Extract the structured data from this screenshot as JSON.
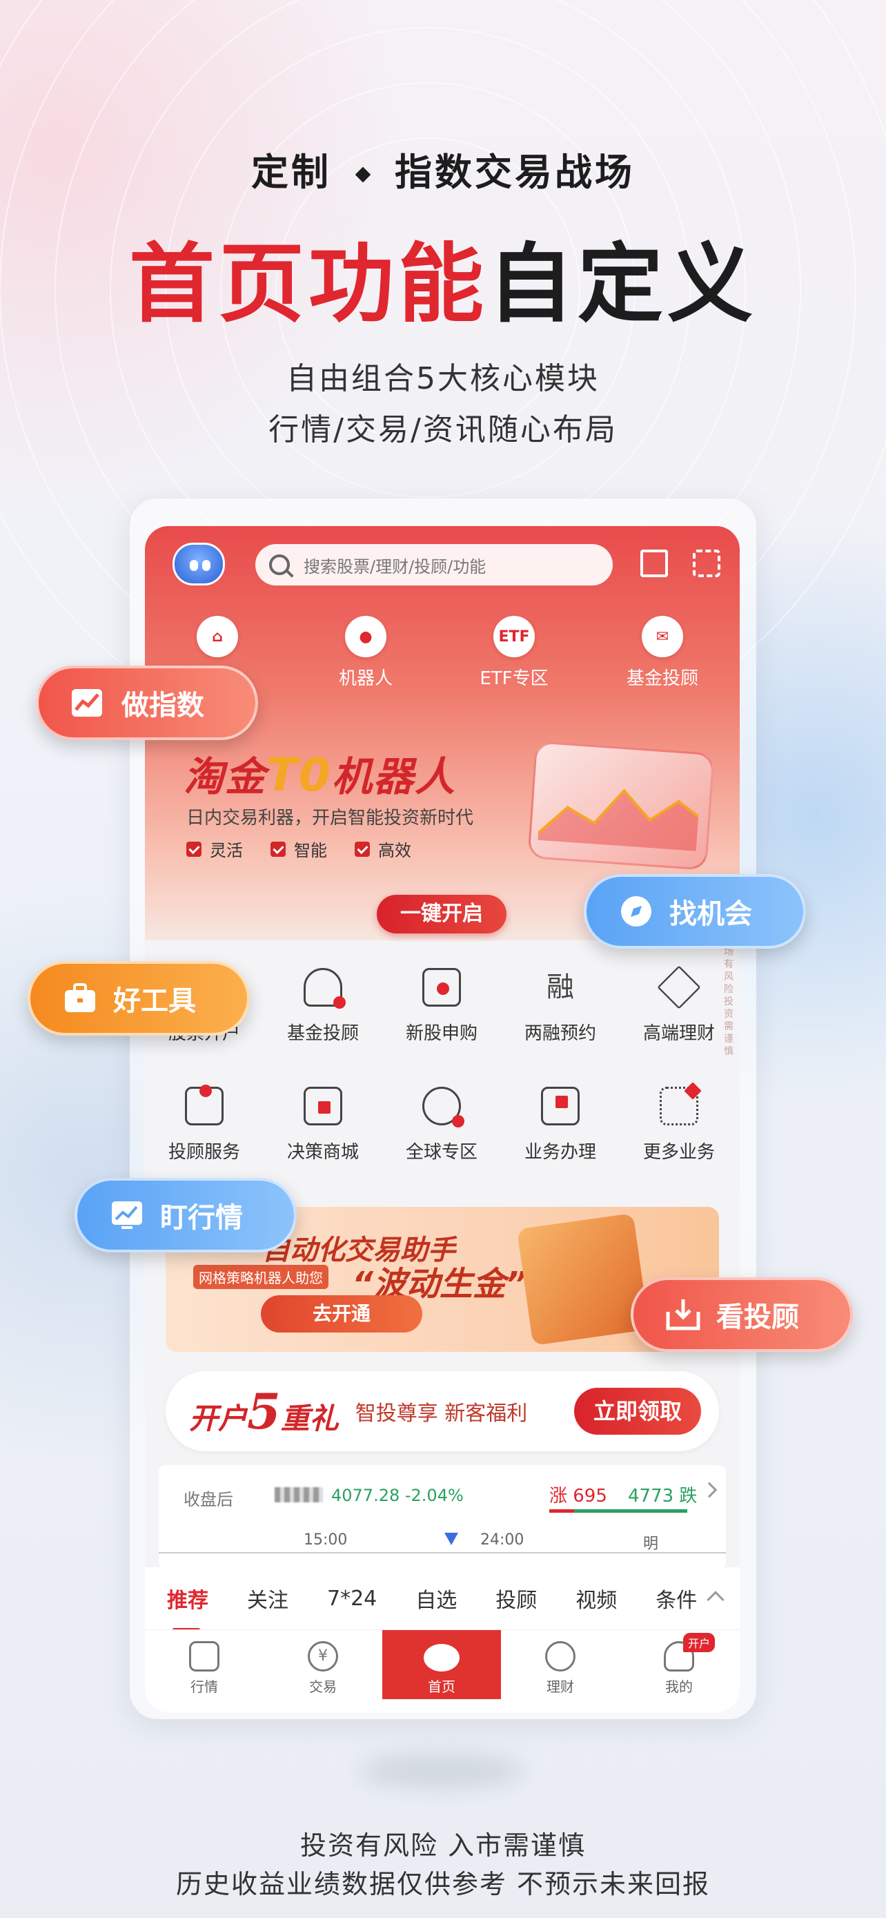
{
  "hero": {
    "left": "定制",
    "right": "指数交易战场",
    "title_red": "首页功能",
    "title_dark": "自定义",
    "line1": "自由组合5大核心模块",
    "line2": "行情/交易/资讯随心布局"
  },
  "app": {
    "search_placeholder": "搜索股票/理财/投顾/功能",
    "quick": [
      {
        "label": "",
        "icon": "home-icon"
      },
      {
        "label": "机器人",
        "icon": "robot-person-icon"
      },
      {
        "label": "ETF专区",
        "icon_text": "ETF"
      },
      {
        "label": "基金投顾",
        "icon": "fund-advisor-icon"
      }
    ],
    "banner1": {
      "title_a": "淘金",
      "title_b": "T0",
      "title_c": "机器人",
      "desc": "日内交易利器，开启智能投资新时代",
      "tags": [
        "灵活",
        "智能",
        "高效"
      ],
      "button": "一键开启",
      "side_note": "市场有风险 投资需谨慎"
    },
    "grid": [
      {
        "label": "股票开户",
        "icon": "account-open-icon"
      },
      {
        "label": "基金投顾",
        "icon": "person-star-icon"
      },
      {
        "label": "新股申购",
        "icon": "ipo-icon"
      },
      {
        "label": "两融预约",
        "icon": "margin-icon",
        "icon_text": "融"
      },
      {
        "label": "高端理财",
        "icon": "diamond-icon"
      },
      {
        "label": "投顾服务",
        "icon": "advisor-service-icon"
      },
      {
        "label": "决策商城",
        "icon": "decision-mall-icon"
      },
      {
        "label": "全球专区",
        "icon": "globe-icon"
      },
      {
        "label": "业务办理",
        "icon": "business-icon"
      },
      {
        "label": "更多业务",
        "icon": "more-grid-icon"
      }
    ],
    "banner2": {
      "title": "自动化交易助手",
      "tag": "网格策略机器人助您",
      "slogan": "“波动生金”",
      "button": "去开通"
    },
    "banner3": {
      "left": "开户",
      "num": "5",
      "right": "重礼",
      "sub": "智投尊享 新客福利",
      "button": "立即领取"
    },
    "ticker": {
      "label": "收盘后",
      "value": "4077.28  -2.04%",
      "up": "涨 695",
      "down": "4773 跌",
      "times": [
        "15:00",
        "24:00",
        "明"
      ]
    },
    "tabs": [
      "推荐",
      "关注",
      "7*24",
      "自选",
      "投顾",
      "视频",
      "条件"
    ],
    "nav": [
      {
        "label": "行情",
        "icon": "quote-icon"
      },
      {
        "label": "交易",
        "icon": "yen-trade-icon"
      },
      {
        "label": "首页",
        "icon": "home-robot-icon"
      },
      {
        "label": "理财",
        "icon": "wealth-icon"
      },
      {
        "label": "我的",
        "icon": "user-icon",
        "badge": "开户"
      }
    ]
  },
  "pills": {
    "index": "做指数",
    "opportunity": "找机会",
    "tools": "好工具",
    "market": "盯行情",
    "advisor": "看投顾"
  },
  "disclaimer": {
    "line1": "投资有风险 入市需谨慎",
    "line2": "历史收益业绩数据仅供参考 不预示未来回报"
  },
  "colors": {
    "brand_red": "#e0262e",
    "pill_blue": "#5aa3f5",
    "pill_orange": "#f58a1f",
    "up_red": "#e0262e",
    "down_green": "#2aa160"
  }
}
